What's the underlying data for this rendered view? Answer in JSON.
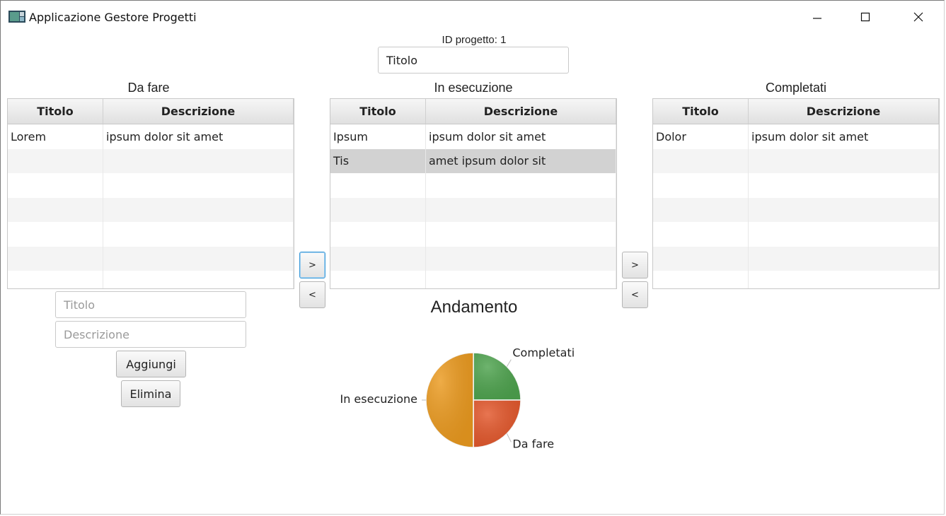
{
  "window": {
    "title": "Applicazione Gestore Progetti",
    "minimize": "—",
    "maximize": "☐",
    "close": "✕"
  },
  "project": {
    "id_label": "ID progetto: 1",
    "title_value": "Titolo"
  },
  "columns": {
    "col1": "Titolo",
    "col2": "Descrizione"
  },
  "todo": {
    "label": "Da fare",
    "rows": [
      {
        "titolo": "Lorem",
        "descrizione": "ipsum dolor sit amet"
      }
    ]
  },
  "inprogress": {
    "label": "In esecuzione",
    "rows": [
      {
        "titolo": "Ipsum",
        "descrizione": "ipsum dolor sit amet"
      },
      {
        "titolo": "Tis",
        "descrizione": "amet ipsum dolor sit"
      }
    ],
    "selected_row": 1
  },
  "done": {
    "label": "Completati",
    "rows": [
      {
        "titolo": "Dolor",
        "descrizione": "ipsum dolor sit amet"
      }
    ]
  },
  "move_buttons": {
    "forward": ">",
    "back": "<"
  },
  "form": {
    "title_placeholder": "Titolo",
    "description_placeholder": "Descrizione",
    "add_label": "Aggiungi",
    "delete_label": "Elimina"
  },
  "chart_data": {
    "type": "pie",
    "title": "Andamento",
    "slices": [
      {
        "label": "Completati",
        "value": 1,
        "color": "#4ea34e"
      },
      {
        "label": "Da fare",
        "value": 1,
        "color": "#e3572b"
      },
      {
        "label": "In esecuzione",
        "value": 2,
        "color": "#eb9a1f"
      }
    ]
  }
}
